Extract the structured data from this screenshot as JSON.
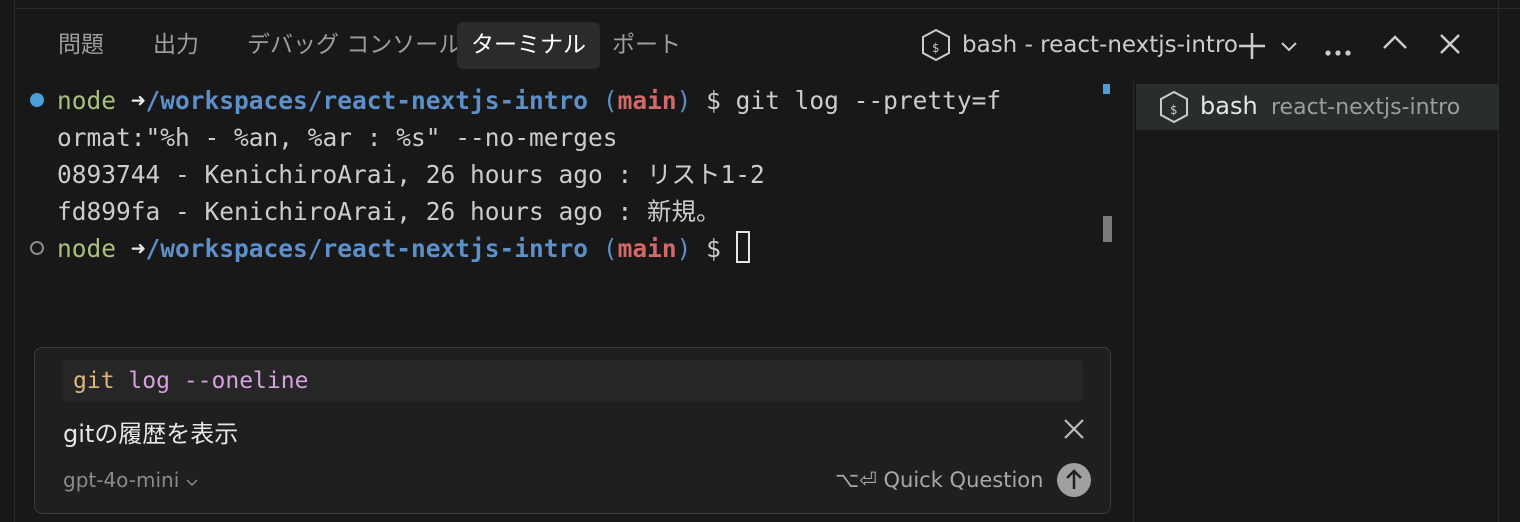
{
  "panel": {
    "tabs": [
      {
        "label": "問題"
      },
      {
        "label": "出力"
      },
      {
        "label": "デバッグ コンソール"
      },
      {
        "label": "ターミナル",
        "active": true
      },
      {
        "label": "ポート"
      }
    ],
    "terminal_title": "bash - react-nextjs-intro",
    "icons": [
      "bash-icon",
      "plus-icon",
      "chevron-down-icon",
      "more-icon",
      "chevron-up-icon",
      "close-icon"
    ]
  },
  "terminal": {
    "line1": {
      "user": "node",
      "arrow": "➜",
      "path": "/workspaces/react-nextjs-intro",
      "paren_open": "(",
      "branch": "main",
      "paren_close": ")",
      "rest": " $ git log --pretty=f"
    },
    "line2": "ormat:\"%h - %an, %ar : %s\" --no-merges",
    "line3": "0893744 - KenichiroArai, 26 hours ago : リスト1-2",
    "line4": "fd899fa - KenichiroArai, 26 hours ago : 新規。",
    "line5": {
      "user": "node",
      "arrow": "➜",
      "path": "/workspaces/react-nextjs-intro",
      "paren_open": "(",
      "branch": "main",
      "paren_close": ")",
      "rest": " $ "
    }
  },
  "side": {
    "item_label": "bash",
    "item_sub": "react-nextjs-intro"
  },
  "chat": {
    "suggest_git": "git",
    "suggest_log": "log",
    "suggest_flag": "--oneline",
    "prompt": "gitの履歴を表示",
    "model": "gpt-4o-mini",
    "shortcut": "⌥⏎",
    "action_label": "Quick Question"
  },
  "colors": {
    "accent_blue": "#4a9fd8",
    "branch_red": "#d16969",
    "node_green": "#a7c080"
  }
}
